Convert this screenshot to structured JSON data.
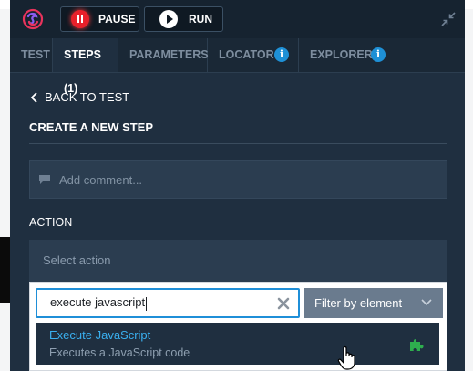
{
  "toolbar": {
    "pause_label": "PAUSE",
    "run_label": "RUN"
  },
  "tabs": [
    {
      "label": "TEST",
      "active": false
    },
    {
      "label": "STEPS (1)",
      "active": true
    },
    {
      "label": "PARAMETERS",
      "active": false
    },
    {
      "label": "LOCATOR",
      "active": false
    },
    {
      "label": "EXPLORER",
      "active": false
    }
  ],
  "info_glyph": "i",
  "step_editor": {
    "back_label": "BACK TO TEST",
    "heading": "CREATE A NEW STEP",
    "comment_placeholder": "Add comment...",
    "action_label": "ACTION",
    "select_placeholder": "Select action"
  },
  "action_dropdown": {
    "search_value": "execute javascript",
    "filter_label": "Filter by element",
    "results": [
      {
        "name": "Execute JavaScript",
        "description": "Executes a JavaScript code",
        "icon": "puzzle-icon"
      }
    ]
  },
  "colors": {
    "panel_bg": "#1f2f40",
    "accent_blue": "#1f8fd8",
    "pause_red": "#e8202a",
    "plugin_green": "#2eae4e",
    "result_link": "#3ab0f0"
  }
}
